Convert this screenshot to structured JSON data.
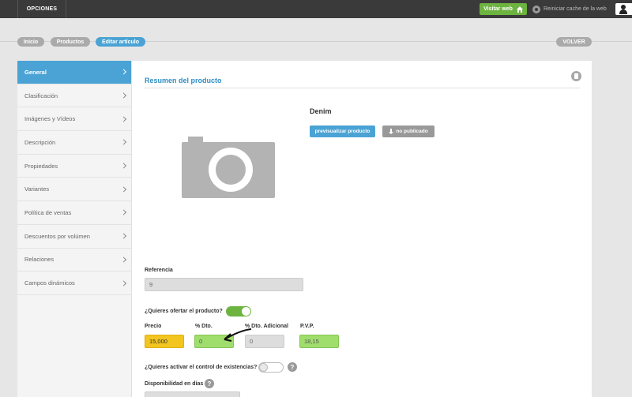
{
  "topbar": {
    "options_label": "OPCIONES",
    "visit_web_label": "Visitar web",
    "reset_cache_label": "Reiniciar cache de la web"
  },
  "breadcrumb": {
    "items": [
      {
        "label": "Inicio"
      },
      {
        "label": "Productos"
      },
      {
        "label": "Editar artículo"
      }
    ],
    "back_label": "VOLVER"
  },
  "sidebar": {
    "items": [
      {
        "label": "General",
        "active": true
      },
      {
        "label": "Clasificación"
      },
      {
        "label": "Imágenes y Vídeos"
      },
      {
        "label": "Descripción"
      },
      {
        "label": "Propiedades"
      },
      {
        "label": "Variantes"
      },
      {
        "label": "Política de ventas"
      },
      {
        "label": "Descuentos por volúmen"
      },
      {
        "label": "Relaciones"
      },
      {
        "label": "Campos dinámicos"
      }
    ]
  },
  "main": {
    "section_title": "Resumen del producto",
    "product_name": "Denim",
    "preview_label": "previsualizar producto",
    "unpublished_label": "no publicado",
    "referencia_label": "Referencia",
    "referencia_value": "9",
    "offer_question": "¿Quieres ofertar el producto?",
    "offer_enabled": true,
    "price": {
      "precio_label": "Precio",
      "precio_value": "15,000",
      "dto_label": "% Dto.",
      "dto_value": "0",
      "dto_adicional_label": "% Dto. Adicional",
      "dto_adicional_value": "0",
      "pvp_label": "P.V.P.",
      "pvp_value": "18,15"
    },
    "stock_question": "¿Quieres activar el control de existencias?",
    "stock_enabled": false,
    "availability_label": "Disponibilidad en días",
    "help_glyph": "?"
  },
  "colors": {
    "accent_blue": "#4aa3d4",
    "green": "#6db33f",
    "yellow": "#f2c51f",
    "light_green": "#9fdd6d",
    "topbar": "#3a3a3a"
  },
  "icons": {
    "visit_web": "home-icon",
    "reset_cache": "refresh-icon",
    "user": "user-icon",
    "delete": "trash-icon",
    "unpublished": "arrow-down-icon",
    "product_image": "camera-icon"
  }
}
